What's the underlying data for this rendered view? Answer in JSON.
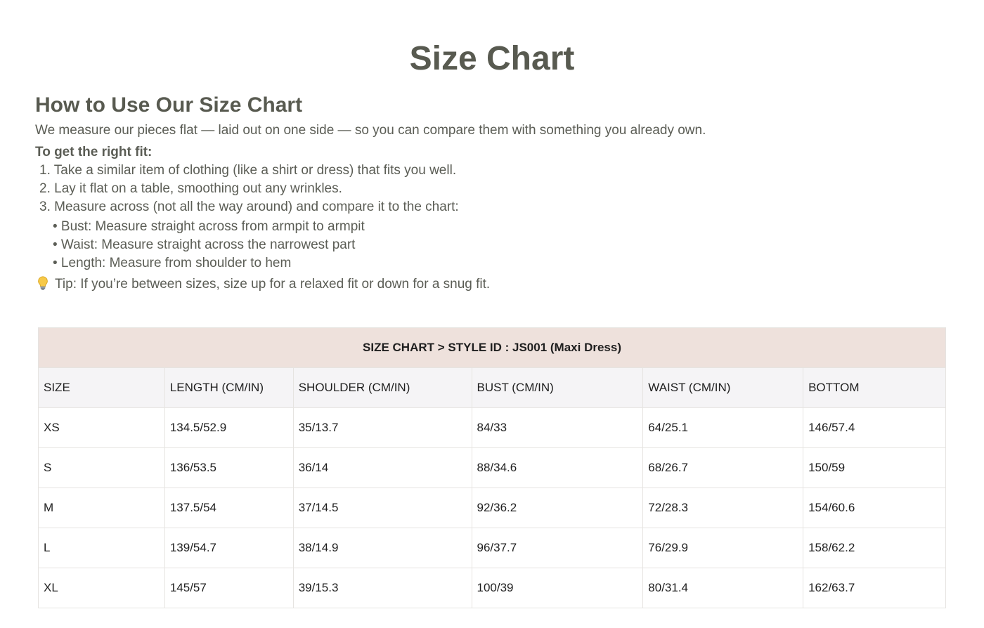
{
  "page": {
    "title": "Size Chart"
  },
  "guide": {
    "heading": "How to Use Our Size Chart",
    "intro": "We measure our pieces flat — laid out on one side — so you can compare them with something you already own.",
    "fit_label": "To get the right fit:",
    "steps": [
      "1. Take a similar item of clothing (like a shirt or dress) that fits you well.",
      "2. Lay it flat on a table, smoothing out any wrinkles.",
      "3. Measure across (not all the way around) and compare it to the chart:"
    ],
    "bullets": [
      "• Bust: Measure straight across from armpit to armpit",
      "• Waist: Measure straight across the narrowest part",
      "• Length: Measure from shoulder to hem"
    ],
    "tip_icon": "lightbulb-icon",
    "tip": "Tip: If you’re between sizes, size up for a relaxed fit or down for a snug fit."
  },
  "table": {
    "caption": "SIZE CHART > STYLE ID : JS001 (Maxi Dress)",
    "headers": [
      "SIZE",
      "LENGTH (CM/IN)",
      "SHOULDER (CM/IN)",
      "BUST (CM/IN)",
      "WAIST (CM/IN)",
      "BOTTOM"
    ],
    "rows": [
      [
        "XS",
        "134.5/52.9",
        "35/13.7",
        "84/33",
        "64/25.1",
        "146/57.4"
      ],
      [
        "S",
        "136/53.5",
        "36/14",
        "88/34.6",
        "68/26.7",
        "150/59"
      ],
      [
        "M",
        "137.5/54",
        "37/14.5",
        "92/36.2",
        "72/28.3",
        "154/60.6"
      ],
      [
        "L",
        "139/54.7",
        "38/14.9",
        "96/37.7",
        "76/29.9",
        "158/62.2"
      ],
      [
        "XL",
        "145/57",
        "39/15.3",
        "100/39",
        "80/31.4",
        "162/63.7"
      ]
    ]
  },
  "colors": {
    "title_text": "#585a50",
    "body_text": "#5b5d55",
    "caption_bg": "#eee1dc",
    "header_bg": "#f5f4f6",
    "border": "#e6e4e1"
  }
}
